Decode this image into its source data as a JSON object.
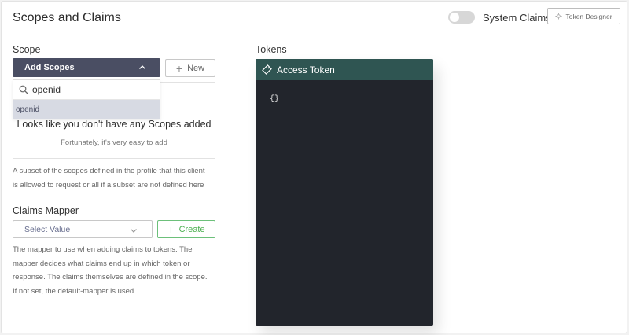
{
  "header": {
    "title": "Scopes and Claims",
    "system_claims_label": "System Claims",
    "system_claims_enabled": false,
    "token_designer_label": "Token Designer"
  },
  "scope": {
    "label": "Scope",
    "add_button_label": "Add Scopes",
    "new_button_label": "New",
    "search_value": "openid",
    "options": [
      "openid"
    ],
    "empty_title": "Looks like you don't have any Scopes added",
    "empty_subtitle": "Fortunately, it's very easy to add",
    "help_lines": [
      "A subset of the scopes defined in the profile that this client",
      "is allowed to request or all if a subset are not defined here"
    ]
  },
  "claims_mapper": {
    "label": "Claims Mapper",
    "select_value": "Select Value",
    "create_button_label": "Create",
    "help_lines": [
      "The mapper to use when adding claims to tokens. The",
      "mapper decides what claims end up in which token or",
      "response. The claims themselves are defined in the scope.",
      "If not set, the default-mapper is used"
    ]
  },
  "tokens": {
    "label": "Tokens",
    "panel_title": "Access Token",
    "content": "{}"
  },
  "colors": {
    "primary_button": "#4a4e63",
    "token_header": "#2f5552",
    "token_body": "#22252c",
    "create_accent": "#4caf50"
  },
  "icons": [
    "designer-icon",
    "chevron-up-icon",
    "plus-icon",
    "search-icon",
    "chevron-down-icon",
    "ticket-icon"
  ]
}
